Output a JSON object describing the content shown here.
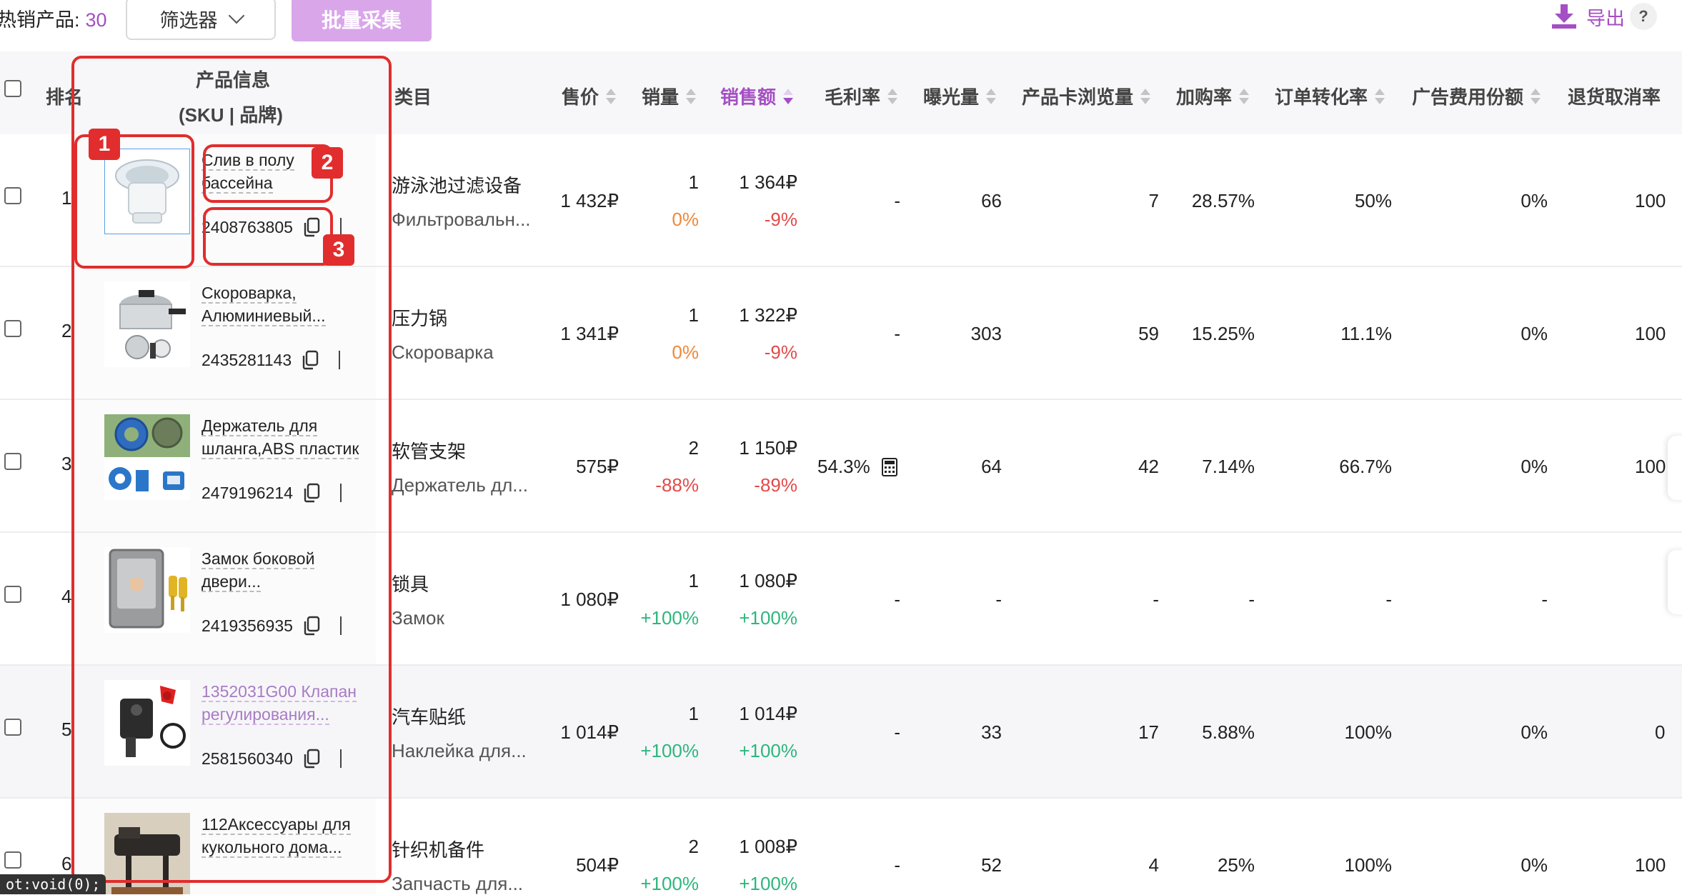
{
  "toolbar": {
    "hot_label": "热销产品:",
    "hot_count": "30",
    "filter_label": "筛选器",
    "batch_label": "批量采集",
    "export_label": "导出",
    "help_label": "?"
  },
  "header": {
    "rank": "排名",
    "product_line1": "产品信息",
    "product_line2": "(SKU | 品牌)",
    "category": "类目",
    "price": "售价",
    "volume": "销量",
    "sales": "销售额",
    "margin": "毛利率",
    "exposure": "曝光量",
    "card_views": "产品卡浏览量",
    "add_cart": "加购率",
    "conversion": "订单转化率",
    "ad_share": "广告费用份额",
    "return_rate": "退货取消率"
  },
  "rows": [
    {
      "rank": "1",
      "name": "Слив в полу бассейна",
      "sku": "2408763805",
      "cat_cn": "游泳池过滤设备",
      "cat_ru": "Фильтровальн...",
      "price": "1 432₽",
      "volume": "1",
      "volume_change": "0%",
      "sales": "1 364₽",
      "sales_change": "-9%",
      "margin": "-",
      "exposure": "66",
      "card_views": "7",
      "add_cart": "28.57%",
      "conversion": "50%",
      "ad_share": "0%",
      "return_rate": "100"
    },
    {
      "rank": "2",
      "name": "Скороварка, Алюминиевый...",
      "sku": "2435281143",
      "cat_cn": "压力锅",
      "cat_ru": "Скороварка",
      "price": "1 341₽",
      "volume": "1",
      "volume_change": "0%",
      "sales": "1 322₽",
      "sales_change": "-9%",
      "margin": "-",
      "exposure": "303",
      "card_views": "59",
      "add_cart": "15.25%",
      "conversion": "11.1%",
      "ad_share": "0%",
      "return_rate": "100"
    },
    {
      "rank": "3",
      "name": "Держатель для шланга,ABS пластик",
      "sku": "2479196214",
      "cat_cn": "软管支架",
      "cat_ru": "Держатель дл...",
      "price": "575₽",
      "volume": "2",
      "volume_change": "-88%",
      "sales": "1 150₽",
      "sales_change": "-89%",
      "margin": "54.3%",
      "exposure": "64",
      "card_views": "42",
      "add_cart": "7.14%",
      "conversion": "66.7%",
      "ad_share": "0%",
      "return_rate": "100"
    },
    {
      "rank": "4",
      "name": "Замок боковой двери...",
      "sku": "2419356935",
      "cat_cn": "锁具",
      "cat_ru": "Замок",
      "price": "1 080₽",
      "volume": "1",
      "volume_change": "+100%",
      "sales": "1 080₽",
      "sales_change": "+100%",
      "margin": "-",
      "exposure": "-",
      "card_views": "-",
      "add_cart": "-",
      "conversion": "-",
      "ad_share": "-",
      "return_rate": ""
    },
    {
      "rank": "5",
      "name": "1352031G00 Клапан регулирования...",
      "sku": "2581560340",
      "cat_cn": "汽车贴纸",
      "cat_ru": "Наклейка для...",
      "price": "1 014₽",
      "volume": "1",
      "volume_change": "+100%",
      "sales": "1 014₽",
      "sales_change": "+100%",
      "margin": "-",
      "exposure": "33",
      "card_views": "17",
      "add_cart": "5.88%",
      "conversion": "100%",
      "ad_share": "0%",
      "return_rate": "0"
    },
    {
      "rank": "6",
      "name": "112Аксессуары для кукольного дома...",
      "sku": "",
      "cat_cn": "针织机备件",
      "cat_ru": "Запчасть для...",
      "price": "504₽",
      "volume": "2",
      "volume_change": "+100%",
      "sales": "1 008₽",
      "sales_change": "+100%",
      "margin": "-",
      "exposure": "52",
      "card_views": "4",
      "add_cart": "25%",
      "conversion": "100%",
      "ad_share": "0%",
      "return_rate": "100"
    }
  ],
  "annotations": {
    "b1": "1",
    "b2": "2",
    "b3": "3"
  },
  "status_tip": "ot:void(0);",
  "colors": {
    "accent": "#a44fc3",
    "batch_bg": "#d9a6ea",
    "annotation": "#e12d2d",
    "positive": "#2eb67d",
    "negative": "#e34a4a",
    "neutral": "#f0883a"
  }
}
